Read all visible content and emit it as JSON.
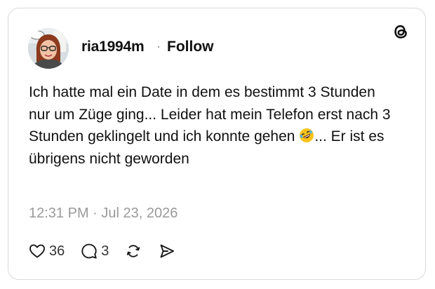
{
  "post": {
    "username": "ria1994m",
    "separator": "·",
    "follow_label": "Follow",
    "text_before_emoji": "Ich hatte mal ein Date in dem es bestimmt 3 Stunden nur um Züge ging... Leider hat mein Telefon erst nach 3 Stunden geklingelt und ich konnte gehen ",
    "emoji_icon": "rolling-on-floor-laughing-emoji",
    "text_after_emoji": "... Er ist es übrigens nicht geworden",
    "timestamp": "12:31 PM · Jul 23, 2026"
  },
  "actions": {
    "likes_count": "36",
    "replies_count": "3",
    "icons": [
      "heart-icon",
      "comment-icon",
      "repost-icon",
      "share-icon"
    ]
  },
  "brand": {
    "logo_icon": "threads-logo-icon",
    "text_color": "#101010",
    "muted_color": "#9a9a9a",
    "border_color": "#d9d9d9"
  }
}
